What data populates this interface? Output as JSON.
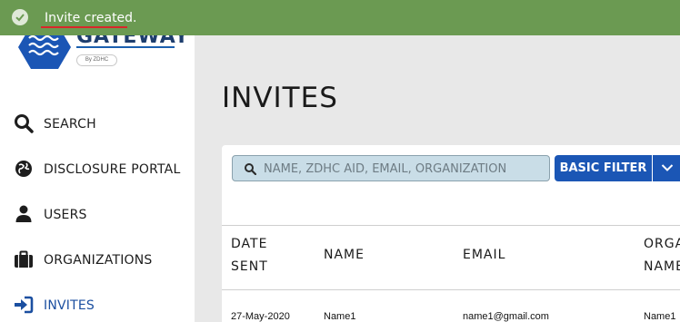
{
  "toast": {
    "message": "Invite created.",
    "status_color": "#6b9a52"
  },
  "logo": {
    "wordmark": "GATEWAY",
    "tagline": "By ZDHC"
  },
  "sidebar": {
    "items": [
      {
        "label": "SEARCH",
        "icon": "search-icon"
      },
      {
        "label": "DISCLOSURE PORTAL",
        "icon": "globe-icon"
      },
      {
        "label": "USERS",
        "icon": "user-icon"
      },
      {
        "label": "ORGANIZATIONS",
        "icon": "briefcase-icon"
      },
      {
        "label": "INVITES",
        "icon": "sign-in-icon",
        "active": true
      }
    ]
  },
  "page": {
    "title": "INVITES"
  },
  "toolbar": {
    "search_placeholder": "NAME, ZDHC AID, EMAIL, ORGANIZATION",
    "filter_label": "BASIC FILTER"
  },
  "table": {
    "headers": [
      {
        "line1": "DATE",
        "line2": "SENT"
      },
      {
        "line1": "NAME",
        "line2": ""
      },
      {
        "line1": "EMAIL",
        "line2": ""
      },
      {
        "line1": "ORGA",
        "line2": "NAME"
      }
    ],
    "rows": [
      {
        "date_sent": "27-May-2020",
        "name": "Name1",
        "email": "name1@gmail.com",
        "organization": "Name1"
      }
    ]
  },
  "colors": {
    "accent": "#1b56b5",
    "active_nav": "#1b4fa0",
    "alert_underline": "#d9262a"
  }
}
